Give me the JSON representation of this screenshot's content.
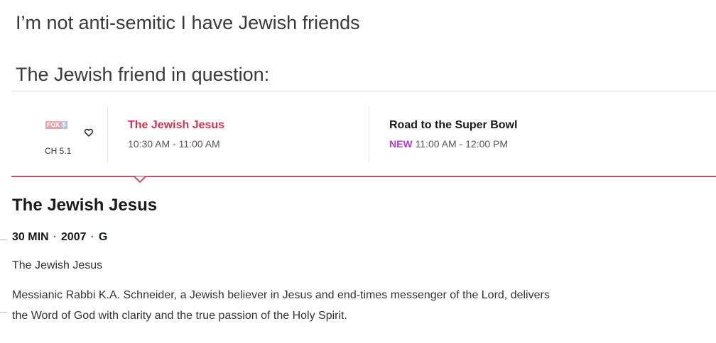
{
  "meme": {
    "caption_line1": "I’m not anti-semitic I have Jewish friends",
    "caption_line2": "The Jewish friend in question:"
  },
  "guide": {
    "channel": {
      "logo_fox": "FOX",
      "logo_num": "5",
      "number": "CH 5.1",
      "favorite_icon": "heart-outline-icon"
    },
    "programs": [
      {
        "title": "The Jewish Jesus",
        "time": "10:30 AM - 11:00 AM",
        "badge": "",
        "title_color": "#d0344f"
      },
      {
        "title": "Road to the Super Bowl",
        "time": "11:00 AM - 12:00 PM",
        "badge": "NEW",
        "title_color": "#1a1a1a"
      }
    ]
  },
  "detail": {
    "title": "The Jewish Jesus",
    "duration": "30 MIN",
    "year": "2007",
    "rating": "G",
    "subtitle": "The Jewish Jesus",
    "description": "Messianic Rabbi K.A. Schneider, a Jewish believer in Jesus and end-times messenger of the Lord, delivers the Word of God with clarity and the true passion of the Holy Spirit."
  },
  "colors": {
    "accent": "#d24b66",
    "new_badge": "#b23ad9"
  }
}
